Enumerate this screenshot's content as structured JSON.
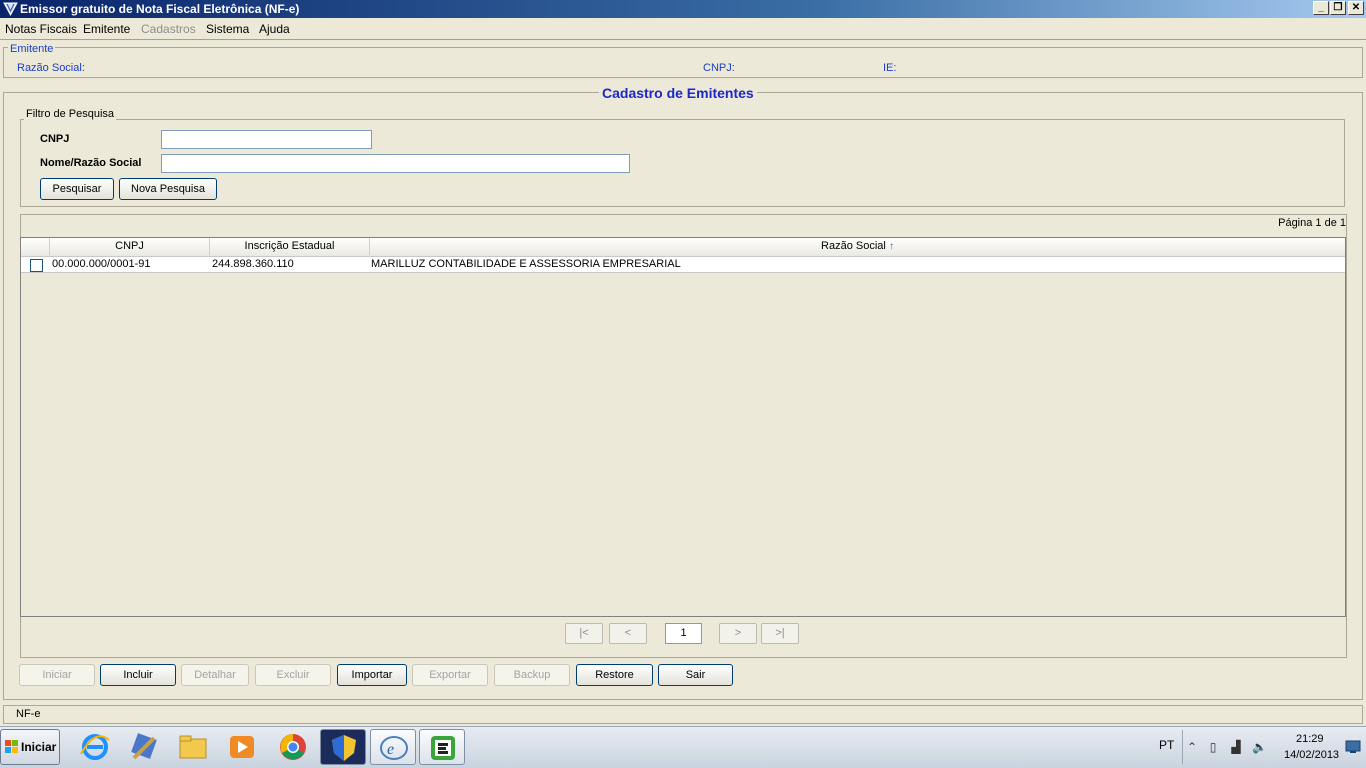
{
  "window": {
    "title": "Emissor gratuito de Nota Fiscal Eletrônica (NF-e)",
    "minimize": "_",
    "restore": "❐",
    "close": "✕"
  },
  "menu": [
    "Notas Fiscais",
    "Emitente",
    "Cadastros",
    "Sistema",
    "Ajuda"
  ],
  "emitente": {
    "legend": "Emitente",
    "razao_label": "Razão Social:",
    "cnpj_label": "CNPJ:",
    "ie_label": "IE:"
  },
  "panel": {
    "title": "Cadastro de Emitentes",
    "filter_legend": "Filtro de Pesquisa",
    "cnpj_label": "CNPJ",
    "cnpj_value": "",
    "nome_label": "Nome/Razão Social",
    "nome_value": "",
    "pesquisar": "Pesquisar",
    "nova_pesquisa": "Nova Pesquisa",
    "page_info": "Página 1 de 1"
  },
  "grid": {
    "columns": [
      "CNPJ",
      "Inscrição Estadual",
      "Razão Social"
    ],
    "sort_indicator": "↑",
    "rows": [
      {
        "cnpj": "00.000.000/0001-91",
        "ie": "244.898.360.110",
        "razao": "MARILLUZ CONTABILIDADE E ASSESSORIA EMPRESARIAL",
        "checked": false
      }
    ]
  },
  "pager": {
    "first": "|<",
    "prev": "<",
    "page": "1",
    "next": ">",
    "last": ">|"
  },
  "actions": {
    "iniciar": "Iniciar",
    "incluir": "Incluir",
    "detalhar": "Detalhar",
    "excluir": "Excluir",
    "importar": "Importar",
    "exportar": "Exportar",
    "backup": "Backup",
    "restore": "Restore",
    "sair": "Sair"
  },
  "status": "NF-e",
  "taskbar": {
    "start_label": "Iniciar",
    "apps": [
      "internet-explorer-icon",
      "tools-icon",
      "folder-icon",
      "media-player-icon",
      "chrome-icon",
      "security-shield-icon",
      "nfe-icon",
      "nfe-e-icon"
    ],
    "lang": "PT",
    "time": "21:29",
    "date": "14/02/2013"
  },
  "colors": {
    "accent_blue": "#1c3ec4",
    "title_gradient_start": "#0a246a",
    "window_bg": "#ece9d8"
  }
}
